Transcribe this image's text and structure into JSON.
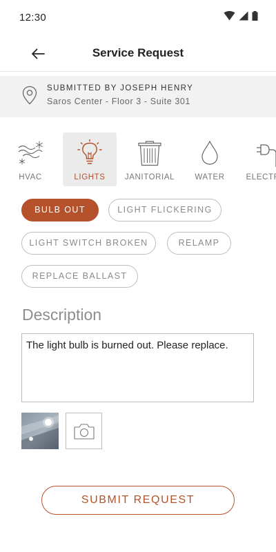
{
  "status_bar": {
    "time": "12:30"
  },
  "app_bar": {
    "title": "Service Request"
  },
  "submitter": {
    "submitted_by": "SUBMITTED BY JOSEPH HENRY",
    "location": "Saros Center - Floor 3 - Suite 301"
  },
  "categories": [
    {
      "label": "HVAC",
      "icon": "hvac-icon",
      "selected": false
    },
    {
      "label": "LIGHTS",
      "icon": "lightbulb-icon",
      "selected": true
    },
    {
      "label": "JANITORIAL",
      "icon": "trash-can-icon",
      "selected": false
    },
    {
      "label": "WATER",
      "icon": "water-drop-icon",
      "selected": false
    },
    {
      "label": "ELECTRICAL",
      "icon": "plug-icon",
      "selected": false
    }
  ],
  "issues": [
    {
      "label": "BULB OUT",
      "selected": true
    },
    {
      "label": "LIGHT FLICKERING",
      "selected": false
    },
    {
      "label": "LIGHT SWITCH BROKEN",
      "selected": false
    },
    {
      "label": "RELAMP",
      "selected": false
    },
    {
      "label": "REPLACE BALLAST",
      "selected": false
    }
  ],
  "description": {
    "heading": "Description",
    "value": "The light bulb is burned out. Please replace."
  },
  "attachments": {
    "photo_icon": "photo-thumbnail",
    "add_icon": "camera-icon"
  },
  "submit_label": "SUBMIT REQUEST",
  "colors": {
    "accent": "#b5512b",
    "muted_text": "#8a8a8a",
    "bar_bg": "#f2f2f2",
    "selected_tile_bg": "#ebebeb"
  }
}
